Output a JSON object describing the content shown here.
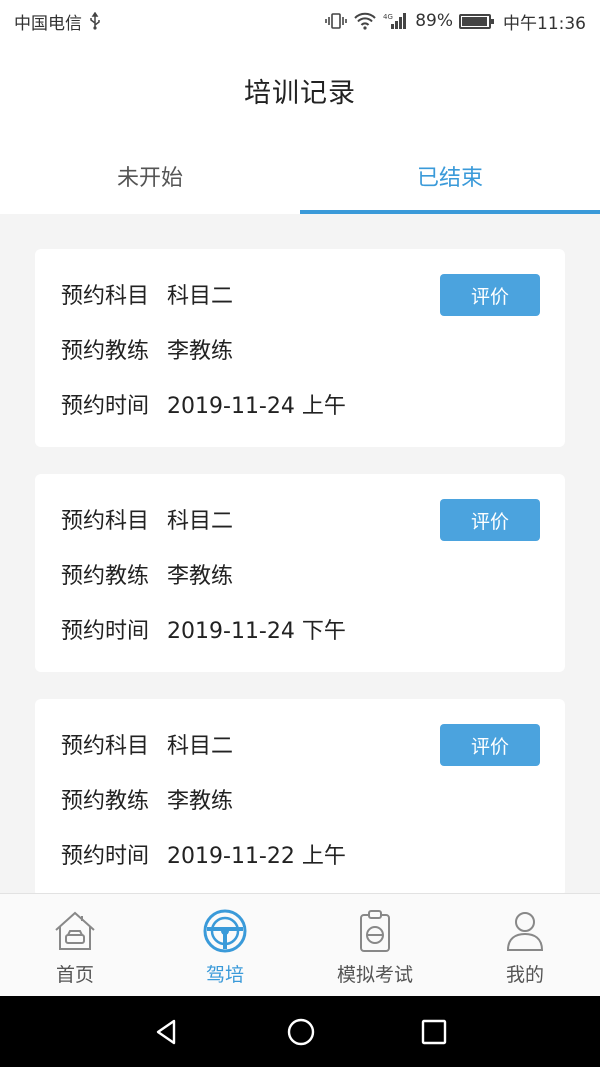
{
  "status_bar": {
    "carrier": "中国电信",
    "network": "4G",
    "battery": "89%",
    "time": "中午11:36"
  },
  "header": {
    "title": "培训记录"
  },
  "tabs": [
    {
      "label": "未开始",
      "active": false
    },
    {
      "label": "已结束",
      "active": true
    }
  ],
  "labels": {
    "subject": "预约科目",
    "coach": "预约教练",
    "time": "预约时间",
    "rate_button": "评价"
  },
  "records": [
    {
      "subject": "科目二",
      "coach": "李教练",
      "time": "2019-11-24 上午"
    },
    {
      "subject": "科目二",
      "coach": "李教练",
      "time": "2019-11-24 下午"
    },
    {
      "subject": "科目二",
      "coach": "李教练",
      "time": "2019-11-22 上午"
    }
  ],
  "bottom_nav": [
    {
      "label": "首页",
      "icon": "home-icon"
    },
    {
      "label": "驾培",
      "icon": "steering-wheel-icon",
      "active": true
    },
    {
      "label": "模拟考试",
      "icon": "clipboard-icon"
    },
    {
      "label": "我的",
      "icon": "user-icon"
    }
  ],
  "colors": {
    "accent": "#3a9ad9",
    "button": "#4ba3de"
  }
}
